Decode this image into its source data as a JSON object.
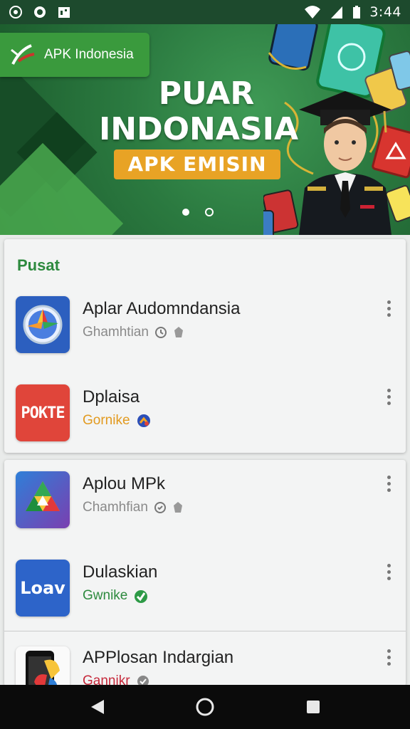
{
  "status_bar": {
    "time": "3:44"
  },
  "banner": {
    "brand": "APK Indonesia",
    "hero_line1": "PUAR",
    "hero_line2": "INDONASIA",
    "hero_tag": "APK EMISIN",
    "carousel": {
      "pages": 2,
      "active": 1
    }
  },
  "section": {
    "title": "Pusat"
  },
  "apps": [
    {
      "name": "Aplar Audomndansia",
      "sub": "Ghamhtian",
      "sub_color": "#8a8a8a",
      "icon": "compass-app-icon",
      "icon_text": ""
    },
    {
      "name": "Dplaisa",
      "sub": "Gornike",
      "sub_color": "#e29a1f",
      "icon": "pokte-app-icon",
      "icon_text": "POKTE"
    },
    {
      "name": "Aplou MPk",
      "sub": "Chamhfian",
      "sub_color": "#8a8a8a",
      "icon": "drive-app-icon",
      "icon_text": ""
    },
    {
      "name": "Dulaskian",
      "sub": "Gwnike",
      "sub_color": "#2d8a3e",
      "icon": "loav-app-icon",
      "icon_text": "Loav"
    },
    {
      "name": "APPlosan Indargian",
      "sub": "Gannikr",
      "sub_color": "#c6283a",
      "icon": "phone-app-icon",
      "icon_text": ""
    }
  ],
  "colors": {
    "status_bar": "#1d4a2d",
    "accent_green": "#2d8a3e",
    "tag_orange": "#e8a325",
    "nav_bar": "#0b0b0b"
  }
}
